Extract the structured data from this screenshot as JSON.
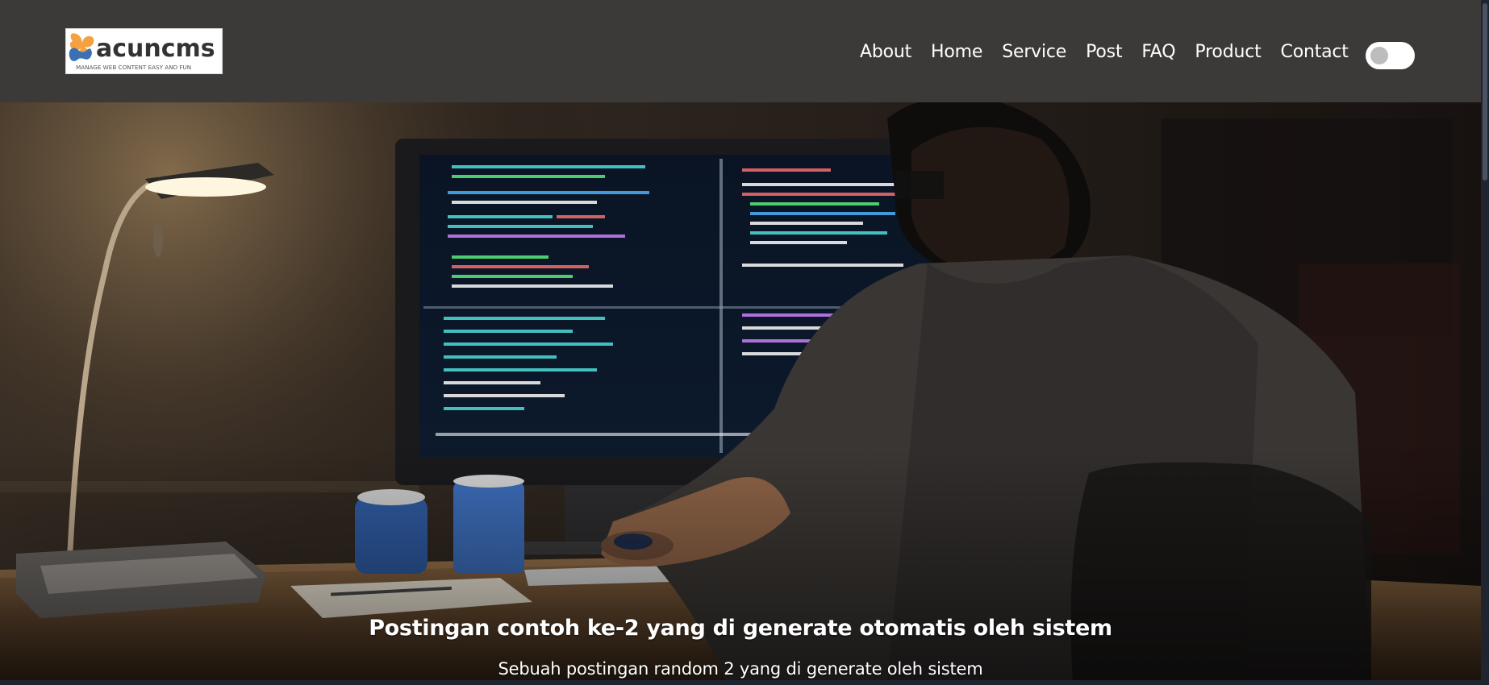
{
  "brand": {
    "name": "acuncms",
    "tagline": "MANAGE WEB CONTENT EASY AND FUN"
  },
  "nav": {
    "items": [
      {
        "label": "About"
      },
      {
        "label": "Home"
      },
      {
        "label": "Service"
      },
      {
        "label": "Post"
      },
      {
        "label": "FAQ"
      },
      {
        "label": "Product"
      },
      {
        "label": "Contact"
      }
    ]
  },
  "theme_toggle": {
    "state": "off"
  },
  "hero": {
    "title": "Postingan contoh ke-2 yang di generate otomatis oleh sistem",
    "subtitle": "Sebuah postingan random 2 yang di generate oleh sistem"
  },
  "colors": {
    "navbar_bg": "#3b3a39",
    "text": "#ffffff",
    "logo_orange": "#f5a142",
    "logo_blue": "#3d6fb5"
  },
  "icons": {
    "logo_mark": "butterfly-logo-icon"
  }
}
